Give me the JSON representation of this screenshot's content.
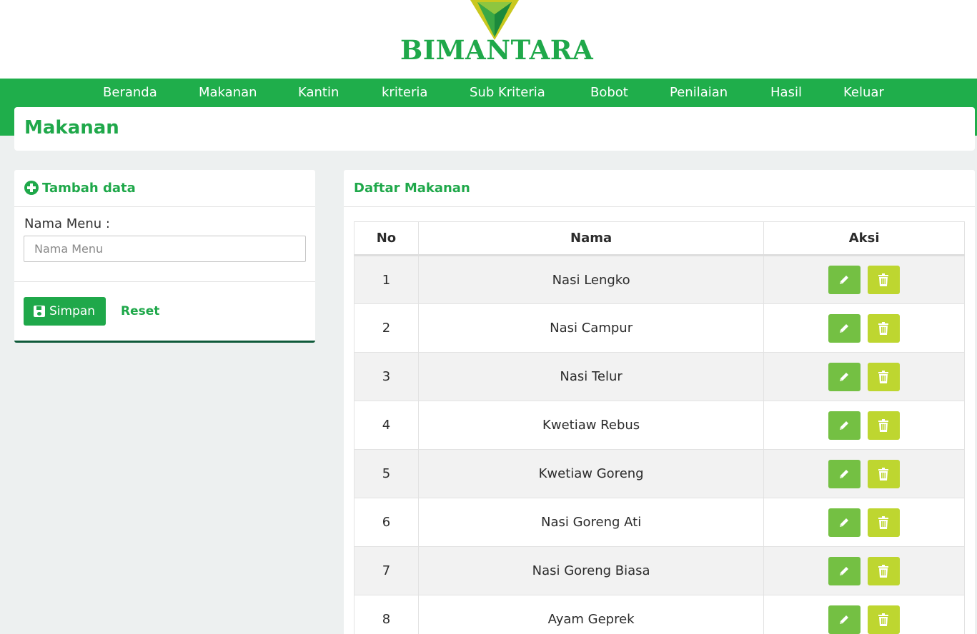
{
  "brand": {
    "name": "BIMANTARA"
  },
  "nav": {
    "items": [
      {
        "label": "Beranda"
      },
      {
        "label": "Makanan"
      },
      {
        "label": "Kantin"
      },
      {
        "label": "kriteria"
      },
      {
        "label": "Sub Kriteria"
      },
      {
        "label": "Bobot"
      },
      {
        "label": "Penilaian"
      },
      {
        "label": "Hasil"
      },
      {
        "label": "Keluar"
      }
    ]
  },
  "page": {
    "title": "Makanan"
  },
  "form": {
    "title": "Tambah data",
    "field_label": "Nama Menu :",
    "field_placeholder": "Nama Menu",
    "field_value": "",
    "save_label": "Simpan",
    "reset_label": "Reset"
  },
  "list": {
    "title": "Daftar Makanan",
    "columns": [
      "No",
      "Nama",
      "Aksi"
    ],
    "rows": [
      {
        "no": "1",
        "nama": "Nasi Lengko"
      },
      {
        "no": "2",
        "nama": "Nasi Campur"
      },
      {
        "no": "3",
        "nama": "Nasi Telur"
      },
      {
        "no": "4",
        "nama": "Kwetiaw Rebus"
      },
      {
        "no": "5",
        "nama": "Kwetiaw Goreng"
      },
      {
        "no": "6",
        "nama": "Nasi Goreng Ati"
      },
      {
        "no": "7",
        "nama": "Nasi Goreng Biasa"
      },
      {
        "no": "8",
        "nama": "Ayam Geprek"
      }
    ]
  },
  "colors": {
    "primary": "#1fae4b",
    "edit_button": "#74c043",
    "delete_button": "#bed630"
  },
  "icons": {
    "add": "plus-circle-icon",
    "save": "floppy-icon",
    "edit": "pencil-icon",
    "delete": "trash-icon"
  }
}
